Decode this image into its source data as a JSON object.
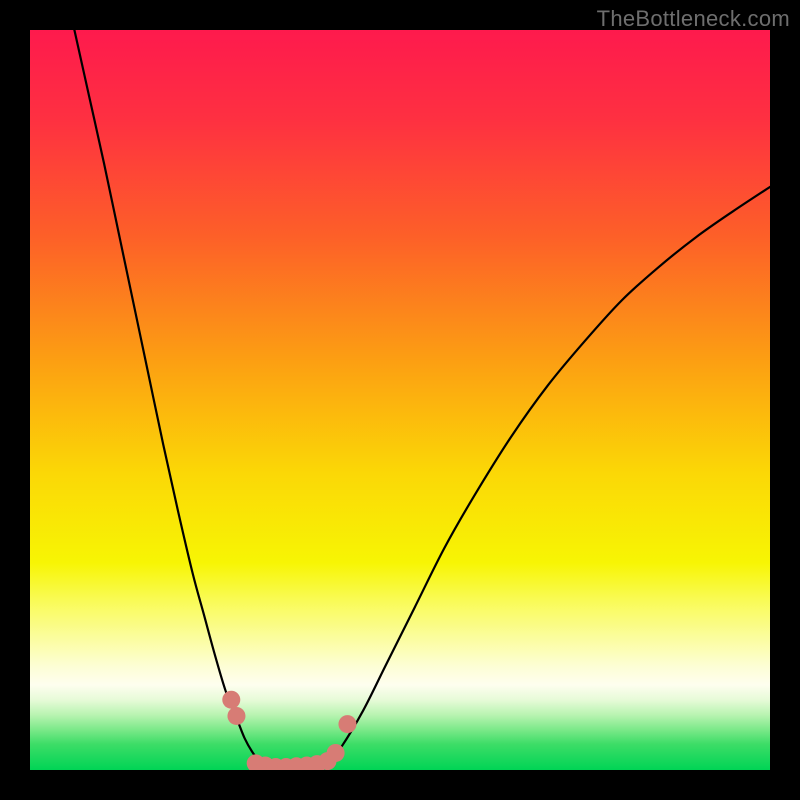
{
  "watermark": "TheBottleneck.com",
  "chart_data": {
    "type": "line",
    "title": "",
    "xlabel": "",
    "ylabel": "",
    "xlim": [
      0,
      100
    ],
    "ylim": [
      0,
      100
    ],
    "series": [
      {
        "name": "left-branch",
        "x": [
          6,
          8,
          10,
          12,
          14,
          16,
          18,
          20,
          22,
          23.5,
          25,
          26.5,
          28,
          29,
          30,
          31,
          32
        ],
        "y": [
          100,
          91,
          82,
          72.5,
          63,
          53.5,
          44,
          35,
          26.5,
          21,
          15.5,
          10.5,
          6.8,
          4.3,
          2.5,
          1.2,
          0.5
        ]
      },
      {
        "name": "right-branch",
        "x": [
          40,
          42,
          45,
          48,
          52,
          56,
          60,
          65,
          70,
          75,
          80,
          85,
          90,
          95,
          100
        ],
        "y": [
          0.5,
          3,
          8,
          14,
          22,
          30,
          37,
          45,
          52,
          58,
          63.5,
          68,
          72,
          75.5,
          78.8
        ]
      }
    ],
    "markers": {
      "name": "pink-dots",
      "color": "#d77c75",
      "radius_px": 9,
      "points": [
        {
          "x": 27.2,
          "y": 9.5
        },
        {
          "x": 27.9,
          "y": 7.3
        },
        {
          "x": 30.5,
          "y": 0.9
        },
        {
          "x": 31.8,
          "y": 0.6
        },
        {
          "x": 33.2,
          "y": 0.4
        },
        {
          "x": 34.6,
          "y": 0.4
        },
        {
          "x": 36.0,
          "y": 0.5
        },
        {
          "x": 37.4,
          "y": 0.6
        },
        {
          "x": 38.8,
          "y": 0.8
        },
        {
          "x": 40.2,
          "y": 1.2
        },
        {
          "x": 41.3,
          "y": 2.3
        },
        {
          "x": 42.9,
          "y": 6.2
        }
      ]
    },
    "background_gradient": {
      "type": "vertical",
      "stops": [
        {
          "pos": 0.0,
          "color": "#fe1a4d"
        },
        {
          "pos": 0.12,
          "color": "#fe3041"
        },
        {
          "pos": 0.28,
          "color": "#fd6028"
        },
        {
          "pos": 0.45,
          "color": "#fca012"
        },
        {
          "pos": 0.6,
          "color": "#fbd806"
        },
        {
          "pos": 0.72,
          "color": "#f7f504"
        },
        {
          "pos": 0.77,
          "color": "#f9fb55"
        },
        {
          "pos": 0.82,
          "color": "#fbfd9c"
        },
        {
          "pos": 0.86,
          "color": "#fdfed5"
        },
        {
          "pos": 0.885,
          "color": "#fefeef"
        },
        {
          "pos": 0.905,
          "color": "#e7fbd8"
        },
        {
          "pos": 0.925,
          "color": "#baf4b2"
        },
        {
          "pos": 0.945,
          "color": "#7de98a"
        },
        {
          "pos": 0.965,
          "color": "#3ddd67"
        },
        {
          "pos": 1.0,
          "color": "#00d455"
        }
      ]
    }
  }
}
